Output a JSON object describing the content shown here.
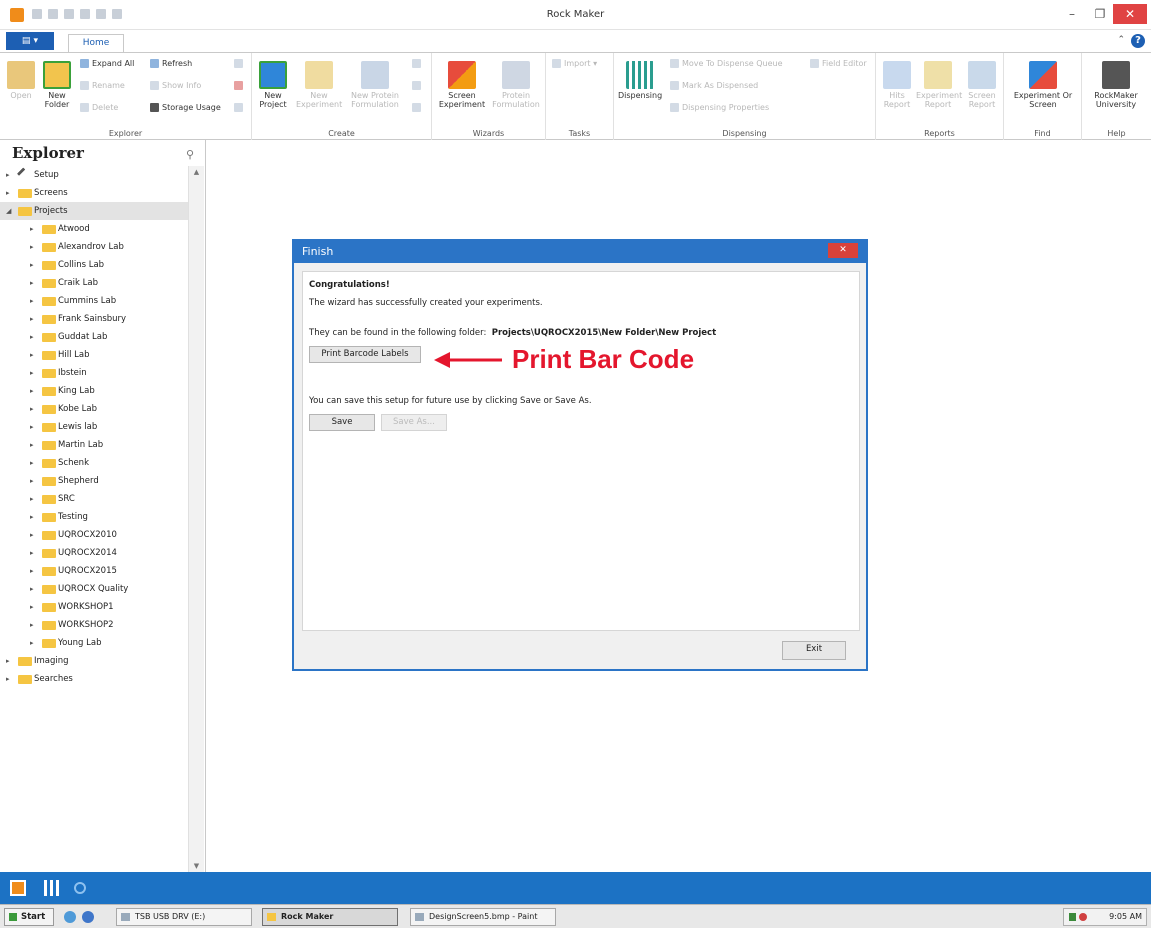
{
  "window": {
    "title": "Rock Maker",
    "minimize": "–",
    "maximize": "❐",
    "close": "✕"
  },
  "ribbon_tabs": {
    "file": "▤ ▾",
    "home": "Home",
    "help_icon": "?",
    "collapse_icon": "⌃"
  },
  "ribbon": {
    "explorer": {
      "label": "Explorer",
      "open": "Open",
      "new_folder": "New Folder",
      "expand_all": "Expand All",
      "refresh": "Refresh",
      "rename": "Rename",
      "show_info": "Show Info",
      "delete": "Delete",
      "storage_usage": "Storage Usage"
    },
    "create": {
      "label": "Create",
      "new_project": "New Project",
      "new_experiment": "New Experiment",
      "new_protein_formulation": "New Protein Formulation"
    },
    "wizards": {
      "label": "Wizards",
      "screen_experiment": "Screen Experiment",
      "protein_formulation": "Protein Formulation"
    },
    "tasks": {
      "label": "Tasks",
      "import": "Import"
    },
    "dispensing": {
      "label": "Dispensing",
      "dispensing": "Dispensing",
      "move_to_dispense_queue": "Move To Dispense Queue",
      "mark_as_dispensed": "Mark As Dispensed",
      "dispensing_properties": "Dispensing Properties",
      "field_editor": "Field Editor"
    },
    "reports": {
      "label": "Reports",
      "hits_report": "Hits Report",
      "experiment_report": "Experiment Report",
      "screen_report": "Screen Report"
    },
    "find": {
      "label": "Find",
      "experiment_or_screen": "Experiment Or Screen"
    },
    "help": {
      "label": "Help",
      "rockmaker_university": "RockMaker University"
    }
  },
  "explorer": {
    "title": "Explorer",
    "pin_icon": "⚲",
    "tree": [
      {
        "label": "Setup",
        "level": 0,
        "arrow": "▸"
      },
      {
        "label": "Screens",
        "level": 0,
        "arrow": "▸"
      },
      {
        "label": "Projects",
        "level": 0,
        "arrow": "◢"
      },
      {
        "label": "Atwood",
        "level": 1,
        "arrow": "▸"
      },
      {
        "label": "Alexandrov Lab",
        "level": 1,
        "arrow": "▸"
      },
      {
        "label": "Collins Lab",
        "level": 1,
        "arrow": "▸"
      },
      {
        "label": "Craik Lab",
        "level": 1,
        "arrow": "▸"
      },
      {
        "label": "Cummins Lab",
        "level": 1,
        "arrow": "▸"
      },
      {
        "label": "Frank Sainsbury",
        "level": 1,
        "arrow": "▸"
      },
      {
        "label": "Guddat Lab",
        "level": 1,
        "arrow": "▸"
      },
      {
        "label": "Hill Lab",
        "level": 1,
        "arrow": "▸"
      },
      {
        "label": "Ibstein",
        "level": 1,
        "arrow": "▸"
      },
      {
        "label": "King Lab",
        "level": 1,
        "arrow": "▸"
      },
      {
        "label": "Kobe Lab",
        "level": 1,
        "arrow": "▸"
      },
      {
        "label": "Lewis lab",
        "level": 1,
        "arrow": "▸"
      },
      {
        "label": "Martin Lab",
        "level": 1,
        "arrow": "▸"
      },
      {
        "label": "Schenk",
        "level": 1,
        "arrow": "▸"
      },
      {
        "label": "Shepherd",
        "level": 1,
        "arrow": "▸"
      },
      {
        "label": "SRC",
        "level": 1,
        "arrow": "▸"
      },
      {
        "label": "Testing",
        "level": 1,
        "arrow": "▸"
      },
      {
        "label": "UQROCX2010",
        "level": 1,
        "arrow": "▸"
      },
      {
        "label": "UQROCX2014",
        "level": 1,
        "arrow": "▸"
      },
      {
        "label": "UQROCX2015",
        "level": 1,
        "arrow": "▸"
      },
      {
        "label": "UQROCX Quality",
        "level": 1,
        "arrow": "▸"
      },
      {
        "label": "WORKSHOP1",
        "level": 1,
        "arrow": "▸"
      },
      {
        "label": "WORKSHOP2",
        "level": 1,
        "arrow": "▸"
      },
      {
        "label": "Young Lab",
        "level": 1,
        "arrow": "▸"
      },
      {
        "label": "Imaging",
        "level": 0,
        "arrow": "▸"
      },
      {
        "label": "Searches",
        "level": 0,
        "arrow": "▸"
      }
    ],
    "selected": "Projects",
    "scroll_up": "▲",
    "scroll_down": "▼"
  },
  "dialog": {
    "title": "Finish",
    "close": "✕",
    "heading": "Congratulations!",
    "message": "The wizard has successfully created your experiments.",
    "folder_label": "They can be found in the following folder:",
    "folder_path": "Projects\\UQROCX2015\\New Folder\\New Project",
    "print_button": "Print Barcode Labels",
    "save_message": "You can save this setup for future use by clicking Save or Save As.",
    "save_button": "Save",
    "save_as_button": "Save As...",
    "exit_button": "Exit"
  },
  "annotation": {
    "text": "Print Bar Code",
    "color": "#e4162d"
  },
  "taskbar": {
    "start": "Start",
    "items": [
      {
        "label": "TSB USB DRV (E:)",
        "active": false
      },
      {
        "label": "Rock Maker",
        "active": true
      },
      {
        "label": "DesignScreen5.bmp - Paint",
        "active": false
      }
    ],
    "clock": "9:05 AM"
  },
  "colors": {
    "accent": "#1c72c4",
    "dialog_border": "#2b74c6",
    "close_red": "#d9423a",
    "folder": "#f5c542"
  }
}
